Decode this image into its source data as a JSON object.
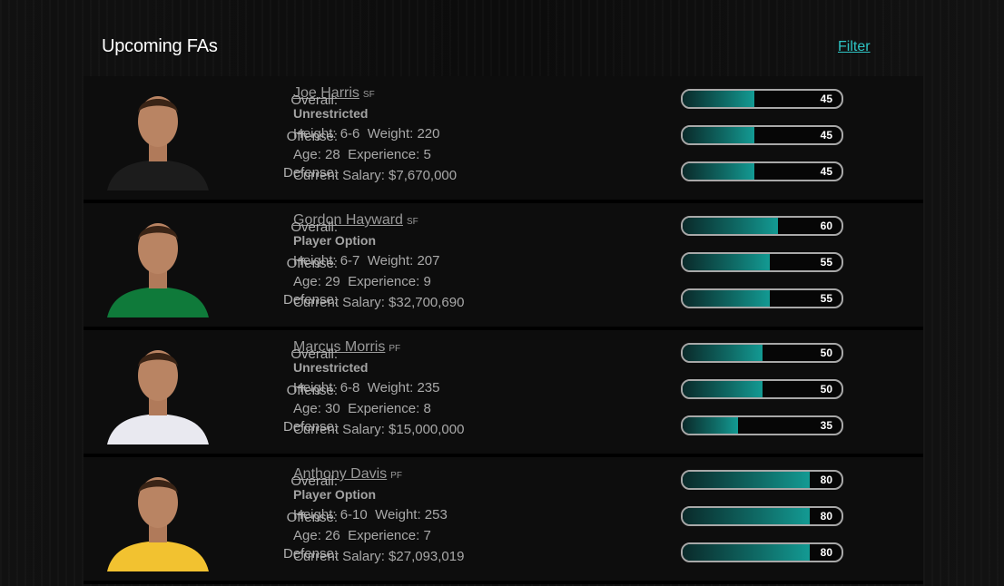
{
  "header": {
    "title": "Upcoming FAs",
    "filter_label": "Filter"
  },
  "players": [
    {
      "name": "Joe Harris",
      "position": "SF",
      "status": "Unrestricted",
      "height_label": "Height: 6-6",
      "weight_label": "Weight: 220",
      "age_label": "Age: 28",
      "experience_label": "Experience: 5",
      "salary_label": "Current Salary: $7,670,000",
      "jersey_color": "#1c1c1c",
      "stats": [
        {
          "label": "Overall:",
          "value": 45
        },
        {
          "label": "Offense:",
          "value": 45
        },
        {
          "label": "Defense:",
          "value": 45
        }
      ]
    },
    {
      "name": "Gordon Hayward",
      "position": "SF",
      "status": "Player Option",
      "height_label": "Height: 6-7",
      "weight_label": "Weight: 207",
      "age_label": "Age: 29",
      "experience_label": "Experience: 9",
      "salary_label": "Current Salary: $32,700,690",
      "jersey_color": "#0f7a3a",
      "stats": [
        {
          "label": "Overall:",
          "value": 60
        },
        {
          "label": "Offense:",
          "value": 55
        },
        {
          "label": "Defense:",
          "value": 55
        }
      ]
    },
    {
      "name": "Marcus Morris",
      "position": "PF",
      "status": "Unrestricted",
      "height_label": "Height: 6-8",
      "weight_label": "Weight: 235",
      "age_label": "Age: 30",
      "experience_label": "Experience: 8",
      "salary_label": "Current Salary: $15,000,000",
      "jersey_color": "#e9e9f0",
      "stats": [
        {
          "label": "Overall:",
          "value": 50
        },
        {
          "label": "Offense:",
          "value": 50
        },
        {
          "label": "Defense:",
          "value": 35
        }
      ]
    },
    {
      "name": "Anthony Davis",
      "position": "PF",
      "status": "Player Option",
      "height_label": "Height: 6-10",
      "weight_label": "Weight: 253",
      "age_label": "Age: 26",
      "experience_label": "Experience: 7",
      "salary_label": "Current Salary: $27,093,019",
      "jersey_color": "#f2c230",
      "stats": [
        {
          "label": "Overall:",
          "value": 80
        },
        {
          "label": "Offense:",
          "value": 80
        },
        {
          "label": "Defense:",
          "value": 80
        }
      ]
    }
  ],
  "bar_colors": {
    "border": "#a8a8a8",
    "fill_end": "#139a93",
    "fill_start": "#0a2a2a"
  }
}
